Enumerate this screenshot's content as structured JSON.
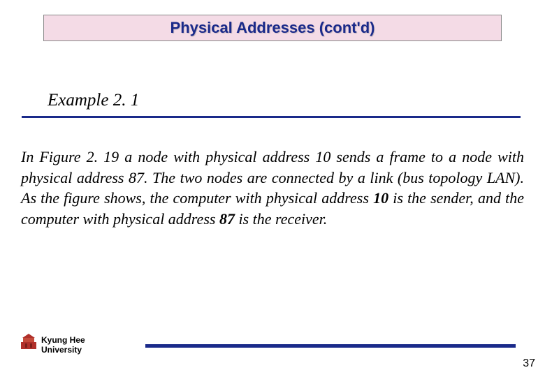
{
  "header": {
    "title": "Physical Addresses (cont'd)"
  },
  "example": {
    "label": "Example 2. 1"
  },
  "body": {
    "part1": "In Figure 2. 19 a node with physical address 10 sends a frame to a node with physical address 87. The two nodes are connected by a link (bus topology LAN). As the figure shows, the computer with physical address ",
    "bold1": "10",
    "part2": " is the sender, and the computer with physical address ",
    "bold2": "87",
    "part3": " is the receiver."
  },
  "footer": {
    "institution_line1": "Kyung Hee",
    "institution_line2": "University",
    "page_number": "37"
  }
}
